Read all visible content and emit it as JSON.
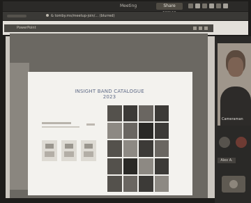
{
  "window": {
    "title": "Meeting"
  },
  "toolbar": {
    "share_label": "Share screen"
  },
  "address_bar": {
    "url": "& tomby.ms/meetup-join/... (blurred)"
  },
  "presentation": {
    "app_label": "PowerPoint"
  },
  "slide": {
    "title": "INSIGHT BAND CATALOGUE 2023"
  },
  "participant": {
    "name": "Cameraman",
    "label": "Alex A."
  },
  "colors": {
    "frame": "#1e1d1b",
    "slide_title": "#5f6a86",
    "end_call": "#6e3b33"
  }
}
